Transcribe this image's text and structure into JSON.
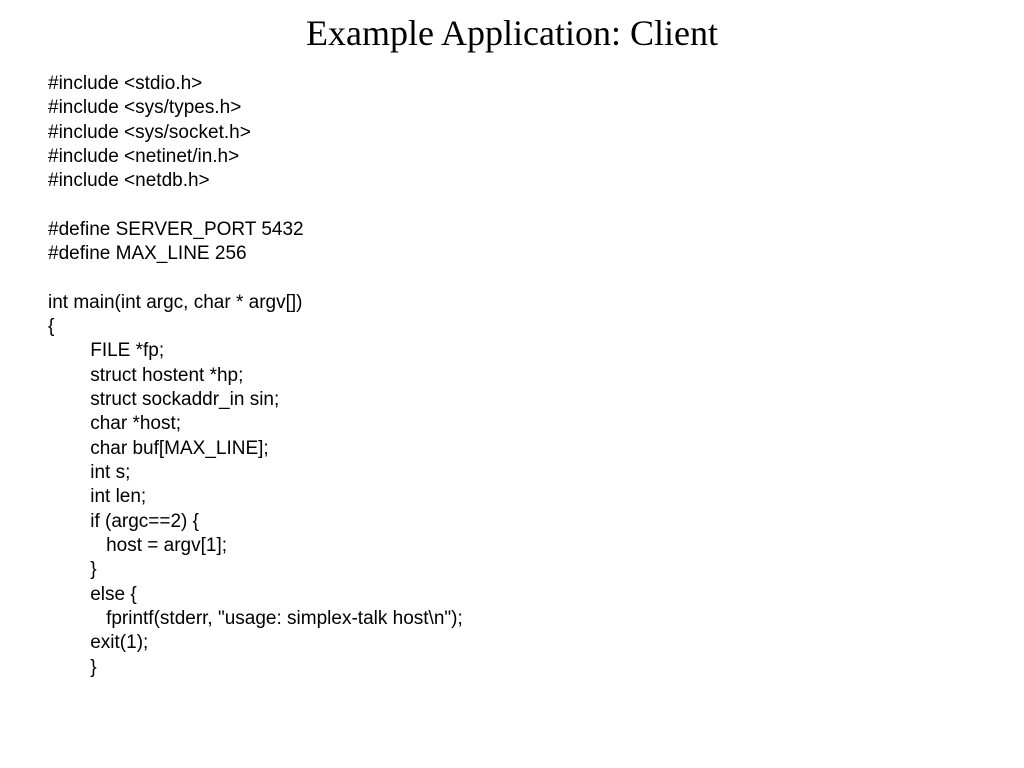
{
  "slide": {
    "title": "Example Application: Client",
    "code": "#include <stdio.h>\n#include <sys/types.h>\n#include <sys/socket.h>\n#include <netinet/in.h>\n#include <netdb.h>\n\n#define SERVER_PORT 5432\n#define MAX_LINE 256\n\nint main(int argc, char * argv[])\n{\n        FILE *fp;\n        struct hostent *hp;\n        struct sockaddr_in sin;\n        char *host;\n        char buf[MAX_LINE];\n        int s;\n        int len;\n        if (argc==2) {\n           host = argv[1];\n        }\n        else {\n           fprintf(stderr, \"usage: simplex-talk host\\n\");\n        exit(1);\n        }"
  }
}
